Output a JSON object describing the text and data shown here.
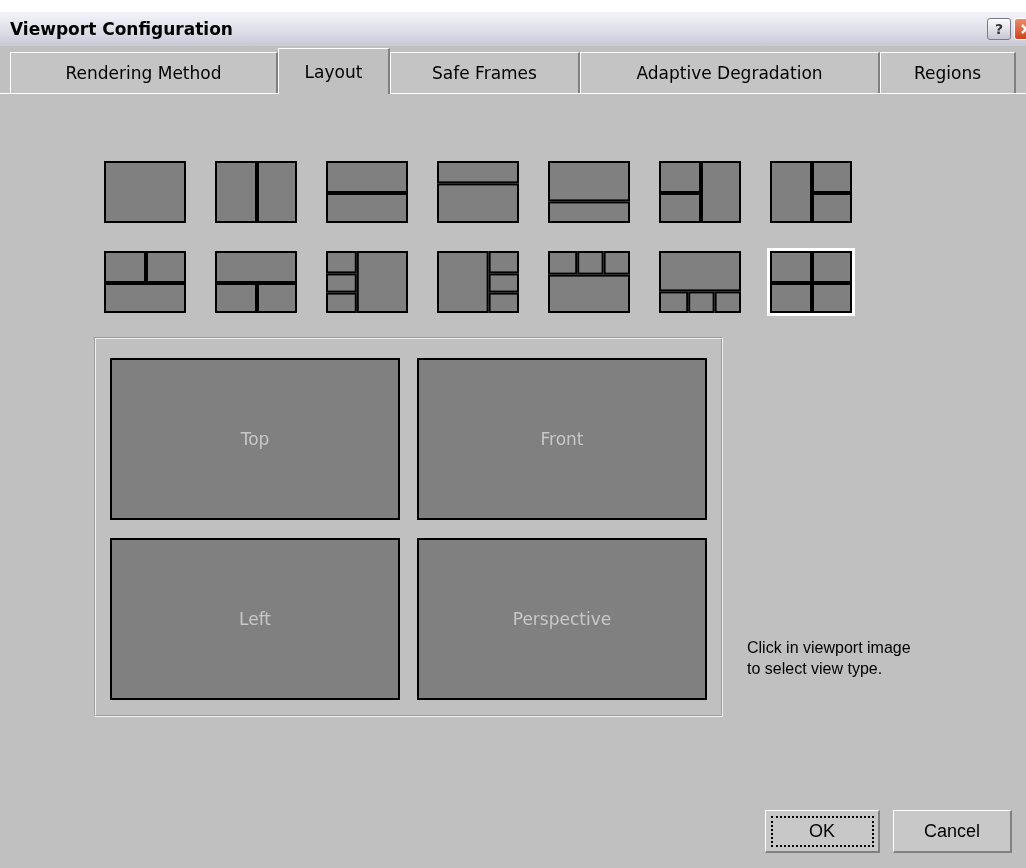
{
  "window": {
    "title": "Viewport Configuration",
    "title_buttons": [
      {
        "kind": "help",
        "label": "?"
      },
      {
        "kind": "close"
      }
    ]
  },
  "tabs": [
    {
      "label": "Rendering Method",
      "selected": false
    },
    {
      "label": "Layout",
      "selected": true
    },
    {
      "label": "Safe Frames",
      "selected": false
    },
    {
      "label": "Adaptive Degradation",
      "selected": false
    },
    {
      "label": "Regions",
      "selected": false
    }
  ],
  "layouts": [
    {
      "kind": "single",
      "selected": false
    },
    {
      "kind": "split-vertical",
      "selected": false
    },
    {
      "kind": "split-horizontal",
      "selected": false
    },
    {
      "kind": "top-small",
      "selected": false
    },
    {
      "kind": "bottom-small",
      "selected": false
    },
    {
      "kind": "left-two",
      "selected": false
    },
    {
      "kind": "right-two",
      "selected": false
    },
    {
      "kind": "top-two",
      "selected": false
    },
    {
      "kind": "bottom-two",
      "selected": false
    },
    {
      "kind": "left-three",
      "selected": false
    },
    {
      "kind": "right-three",
      "selected": false
    },
    {
      "kind": "top-three",
      "selected": false
    },
    {
      "kind": "bottom-three",
      "selected": false
    },
    {
      "kind": "grid-four",
      "selected": true
    }
  ],
  "viewports": [
    {
      "label": "Top"
    },
    {
      "label": "Front"
    },
    {
      "label": "Left"
    },
    {
      "label": "Perspective"
    }
  ],
  "hint": "Click in viewport image to select view type.",
  "buttons": [
    {
      "label": "OK",
      "focused": true
    },
    {
      "label": "Cancel",
      "focused": false
    }
  ]
}
